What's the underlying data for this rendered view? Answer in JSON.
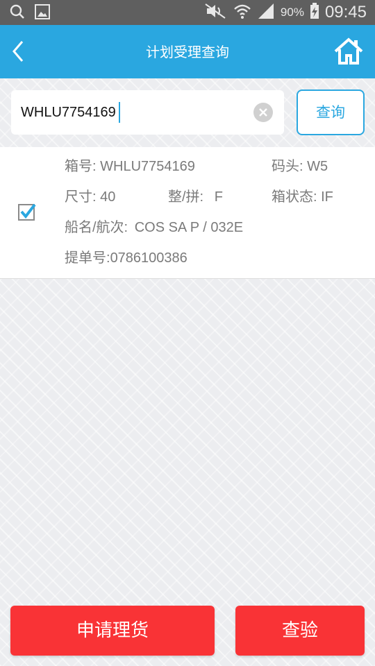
{
  "status_bar": {
    "battery_percent": "90%",
    "time": "09:45",
    "icons": [
      "search-icon",
      "image-icon",
      "mute-icon",
      "wifi-icon",
      "signal-icon",
      "battery-icon"
    ]
  },
  "header": {
    "title": "计划受理查询"
  },
  "search": {
    "value": "WHLU7754169",
    "query_label": "查询"
  },
  "result": {
    "checked": true,
    "box_no_label": "箱号:",
    "box_no": "WHLU7754169",
    "terminal_label": "码头:",
    "terminal": "W5",
    "size_label": "尺寸:",
    "size": "40",
    "fcl_label": "整/拼:",
    "fcl": "F",
    "status_label": "箱状态:",
    "status": "IF",
    "vessel_label": "船名/航次:",
    "vessel": "COS SA P / 032E",
    "bl_label": "提单号:",
    "bl": "0786100386"
  },
  "actions": {
    "apply_label": "申请理货",
    "inspect_label": "查验"
  },
  "colors": {
    "accent": "#2aa7e0",
    "danger": "#f93336"
  }
}
